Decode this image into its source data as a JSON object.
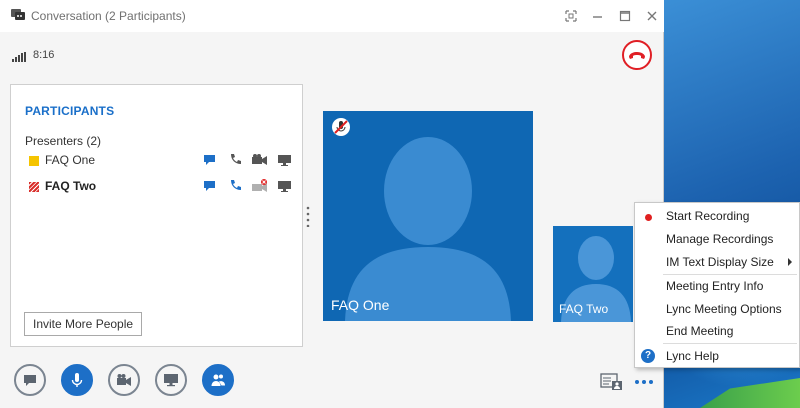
{
  "window": {
    "title": "Conversation (2 Participants)"
  },
  "call": {
    "duration": "8:16"
  },
  "participants_panel": {
    "heading": "PARTICIPANTS",
    "group_label": "Presenters (2)",
    "participants": [
      {
        "name": "FAQ One",
        "color": "#f5c400"
      },
      {
        "name": "FAQ Two",
        "color": "#d9302c"
      }
    ],
    "invite_label": "Invite More People"
  },
  "videos": {
    "main_name": "FAQ One",
    "self_name": "FAQ Two"
  },
  "menu": {
    "items": [
      {
        "label": "Start Recording"
      },
      {
        "label": "Manage Recordings"
      },
      {
        "label": "IM Text Display Size"
      },
      {
        "label": "Meeting Entry Info"
      },
      {
        "label": "Lync Meeting Options"
      },
      {
        "label": "End Meeting"
      },
      {
        "label": "Lync Help"
      }
    ]
  },
  "colors": {
    "accent": "#1d6fc7",
    "hangup": "#e01f25",
    "video_bg": "#0f67b3"
  },
  "icons": {
    "titlebar": [
      "lync-app-icon",
      "fullscreen-icon",
      "minimize-icon",
      "maximize-icon",
      "close-icon"
    ],
    "toolbar": [
      "im-icon",
      "microphone-icon",
      "video-camera-icon",
      "present-screen-icon",
      "participants-icon"
    ]
  }
}
